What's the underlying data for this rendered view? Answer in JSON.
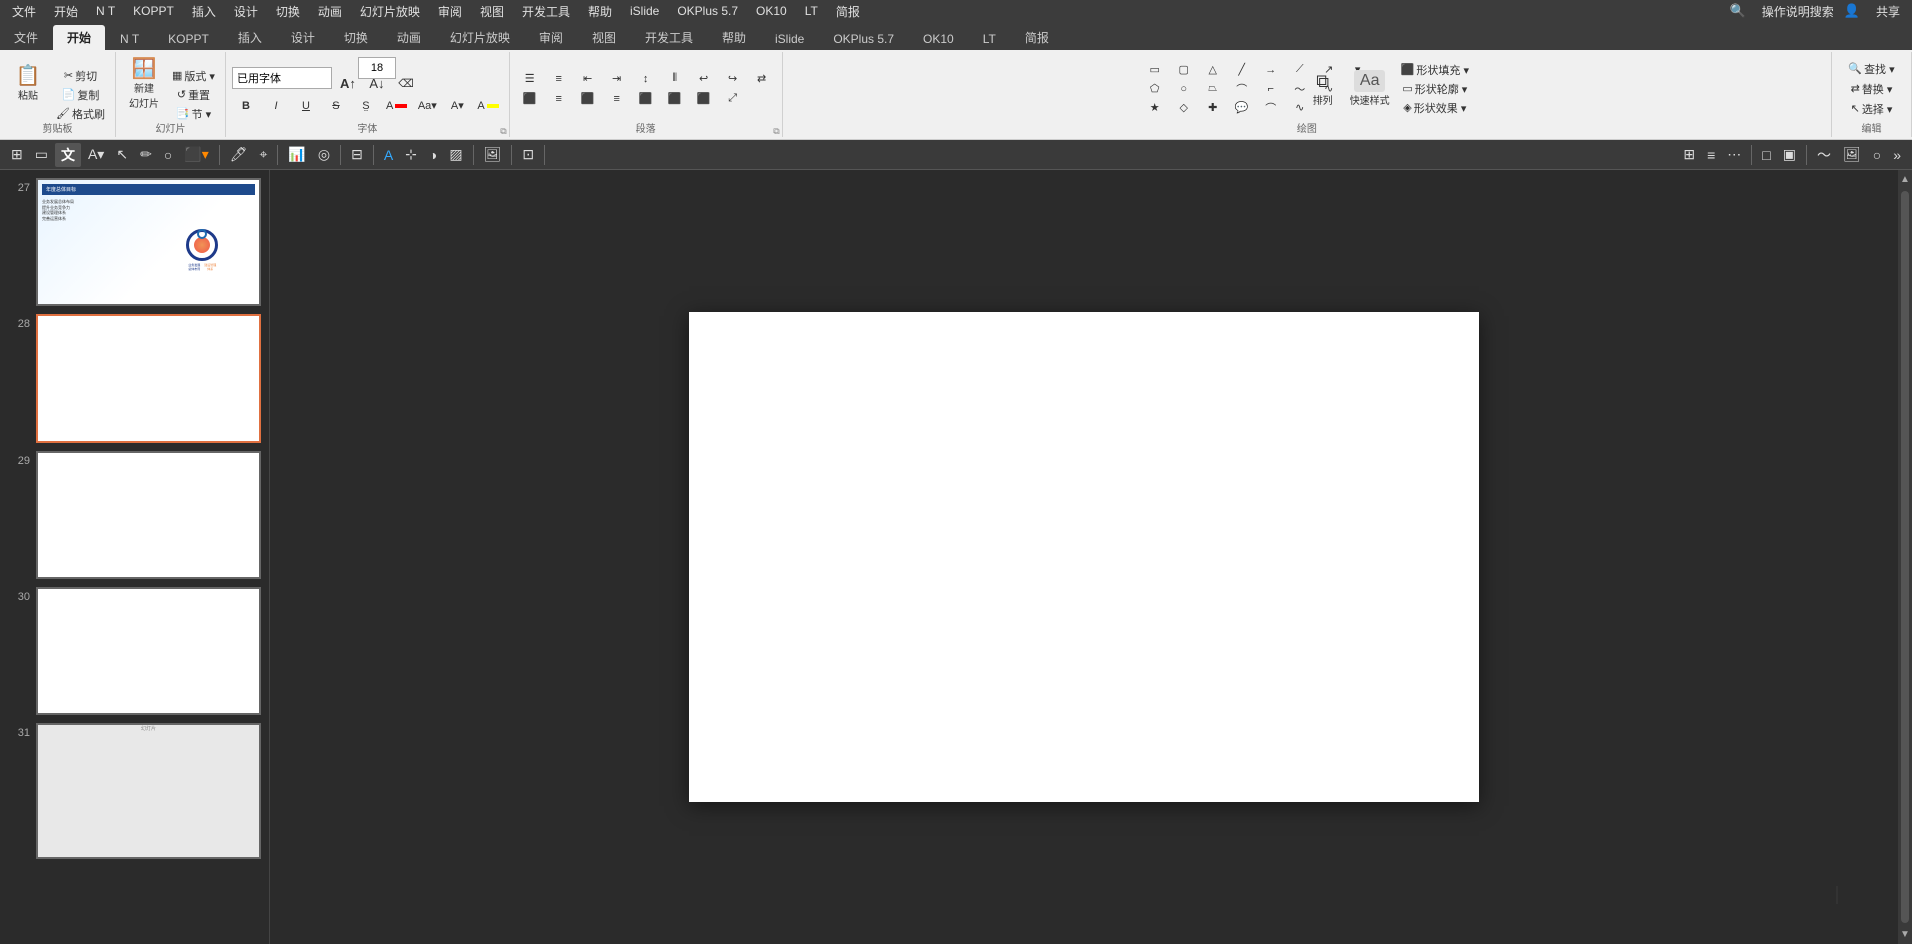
{
  "menubar": {
    "items": [
      "文件",
      "开始",
      "N T",
      "KOPPT",
      "插入",
      "设计",
      "切换",
      "动画",
      "幻灯片放映",
      "审阅",
      "视图",
      "开发工具",
      "帮助",
      "iSlide",
      "OKPlus 5.7",
      "OK10",
      "LT",
      "简报",
      "操作说明搜索",
      "共享"
    ]
  },
  "ribbon": {
    "active_tab": "开始",
    "tabs": [
      "文件",
      "开始",
      "N T",
      "KOPPT",
      "插入",
      "设计",
      "切换",
      "动画",
      "幻灯片放映",
      "审阅",
      "视图",
      "开发工具",
      "帮助",
      "iSlide",
      "OKPlus 5.7",
      "OK10",
      "LT",
      "简报"
    ],
    "groups": {
      "clipboard": {
        "label": "剪贴板",
        "buttons": [
          "粘贴",
          "剪切",
          "复制",
          "格式刷"
        ]
      },
      "slides": {
        "label": "幻灯片",
        "buttons": [
          "新建\n幻灯片",
          "版式",
          "重置",
          "节"
        ]
      },
      "font": {
        "label": "字体",
        "name": "已用字体",
        "size": "18"
      },
      "paragraph": {
        "label": "段落"
      },
      "drawing": {
        "label": "绘图"
      },
      "editing": {
        "label": "编辑",
        "buttons": [
          "查找",
          "替换",
          "选择"
        ]
      }
    }
  },
  "toolbar2": {
    "items": [
      "grid",
      "text",
      "A",
      "cursor",
      "circle",
      "color",
      "pen",
      "select",
      "chart",
      "ring",
      "table",
      "A-text",
      "shape",
      "opacity",
      "shadow",
      "picture",
      "screen",
      "more"
    ]
  },
  "slides": [
    {
      "num": "27",
      "active": false,
      "has_content": true
    },
    {
      "num": "28",
      "active": true,
      "has_content": false
    },
    {
      "num": "29",
      "active": false,
      "has_content": false
    },
    {
      "num": "30",
      "active": false,
      "has_content": false
    },
    {
      "num": "31",
      "active": false,
      "has_content": false
    }
  ],
  "canvas": {
    "slide_num": 28,
    "bg_color": "#ffffff"
  },
  "font_name_placeholder": "已用字体",
  "font_size_value": "18",
  "search_placeholder": "操作说明搜索"
}
